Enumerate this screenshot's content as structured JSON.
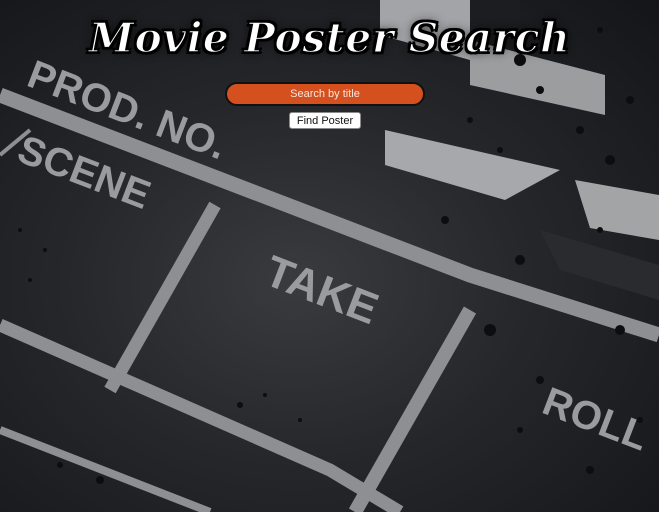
{
  "header": {
    "title": "Movie Poster Search"
  },
  "search": {
    "placeholder": "Search by title",
    "value": ""
  },
  "actions": {
    "find_label": "Find Poster"
  },
  "background": {
    "description_icon": "clapperboard-image",
    "board_labels": {
      "prod_no": "PROD. NO.",
      "scene": "SCENE",
      "take": "TAKE",
      "roll": "ROLL"
    }
  },
  "colors": {
    "accent": "#d5501f",
    "title": "#ffffff",
    "background": "#1a1b1f",
    "board_lines": "#8e8f92"
  }
}
